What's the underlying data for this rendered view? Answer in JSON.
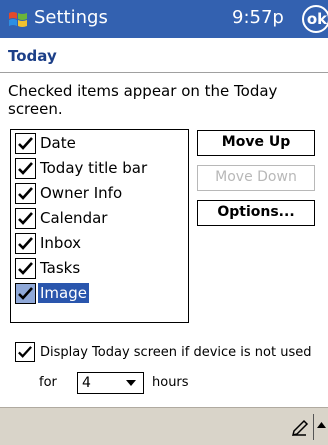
{
  "titlebar": {
    "app_title": "Settings",
    "time": "9:57p",
    "ok_label": "ok"
  },
  "page": {
    "title": "Today"
  },
  "instruction": "Checked items appear on the Today screen.",
  "items": [
    {
      "label": "Date",
      "checked": true,
      "selected": false
    },
    {
      "label": "Today title bar",
      "checked": true,
      "selected": false
    },
    {
      "label": "Owner Info",
      "checked": true,
      "selected": false
    },
    {
      "label": "Calendar",
      "checked": true,
      "selected": false
    },
    {
      "label": "Inbox",
      "checked": true,
      "selected": false
    },
    {
      "label": "Tasks",
      "checked": true,
      "selected": false
    },
    {
      "label": "Image",
      "checked": true,
      "selected": true
    }
  ],
  "buttons": {
    "move_up": "Move Up",
    "move_down": "Move Down",
    "options": "Options..."
  },
  "display_option": {
    "label": "Display Today screen if device is not used",
    "checked": true,
    "for_label": "for",
    "hours_value": "4",
    "hours_label": "hours"
  },
  "icons": {
    "logo": "windows-flag-icon",
    "pen": "pen-icon",
    "up": "arrow-up-icon"
  },
  "colors": {
    "title_bar": "#3361b0",
    "selection": "#2a56ad",
    "header_text": "#1c3f88"
  }
}
